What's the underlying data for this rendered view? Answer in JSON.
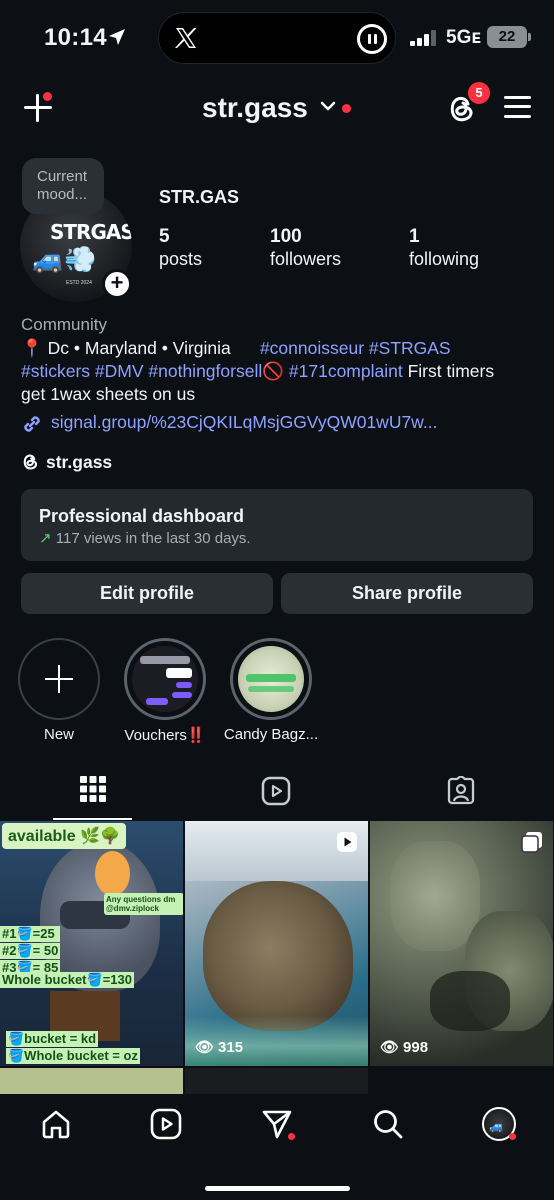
{
  "status_bar": {
    "time": "10:14",
    "network": "5Gᴇ",
    "battery": "22"
  },
  "header": {
    "username": "str.gass",
    "threads_badge": "5"
  },
  "profile": {
    "mood_note": "Current mood...",
    "avatar_text": "STRGAS",
    "avatar_estd": "ESTD 2024",
    "display_name": "STR.GAS",
    "stats": [
      {
        "value": "5",
        "label": "posts"
      },
      {
        "value": "100",
        "label": "followers"
      },
      {
        "value": "1",
        "label": "following"
      }
    ],
    "category": "Community",
    "bio": {
      "line1_pre": "📍 Dc • Maryland • Virginia",
      "line1_tags": "#connoisseur #STRGAS",
      "line2_tags": "#stickers #DMV #nothingforsell",
      "line2_emoji": "🚫",
      "line2_tag2": "#171complaint",
      "line2_text": " First timers",
      "line3": "get 1wax sheets on us"
    },
    "link": "signal.group/%23CjQKILqMsjGGVyQW01wU7w...",
    "threads_handle": "str.gass"
  },
  "dashboard": {
    "title": "Professional dashboard",
    "arrow": "↗",
    "subtitle": "117 views in the last 30 days."
  },
  "buttons": {
    "edit": "Edit profile",
    "share": "Share profile"
  },
  "highlights": [
    {
      "label": "New"
    },
    {
      "label": "Vouchers‼️"
    },
    {
      "label": "Candy Bagz..."
    }
  ],
  "posts": [
    {
      "caption_top": "available 🌿🌳",
      "promo": "Any questions dm @dmv.ziplock",
      "prices": [
        "#1🪣=25",
        "#2🪣= 50",
        "#3🪣= 85",
        "Whole bucket🪣=130"
      ],
      "bottom": [
        "🪣bucket = kd",
        "🪣Whole bucket = oz"
      ],
      "views": ""
    },
    {
      "views": "315"
    },
    {
      "views": "998"
    }
  ],
  "colors": {
    "background": "#0c0f14",
    "accent_link": "#8ea3ff",
    "notification": "#ff3040",
    "button_bg": "#2a2e35"
  }
}
